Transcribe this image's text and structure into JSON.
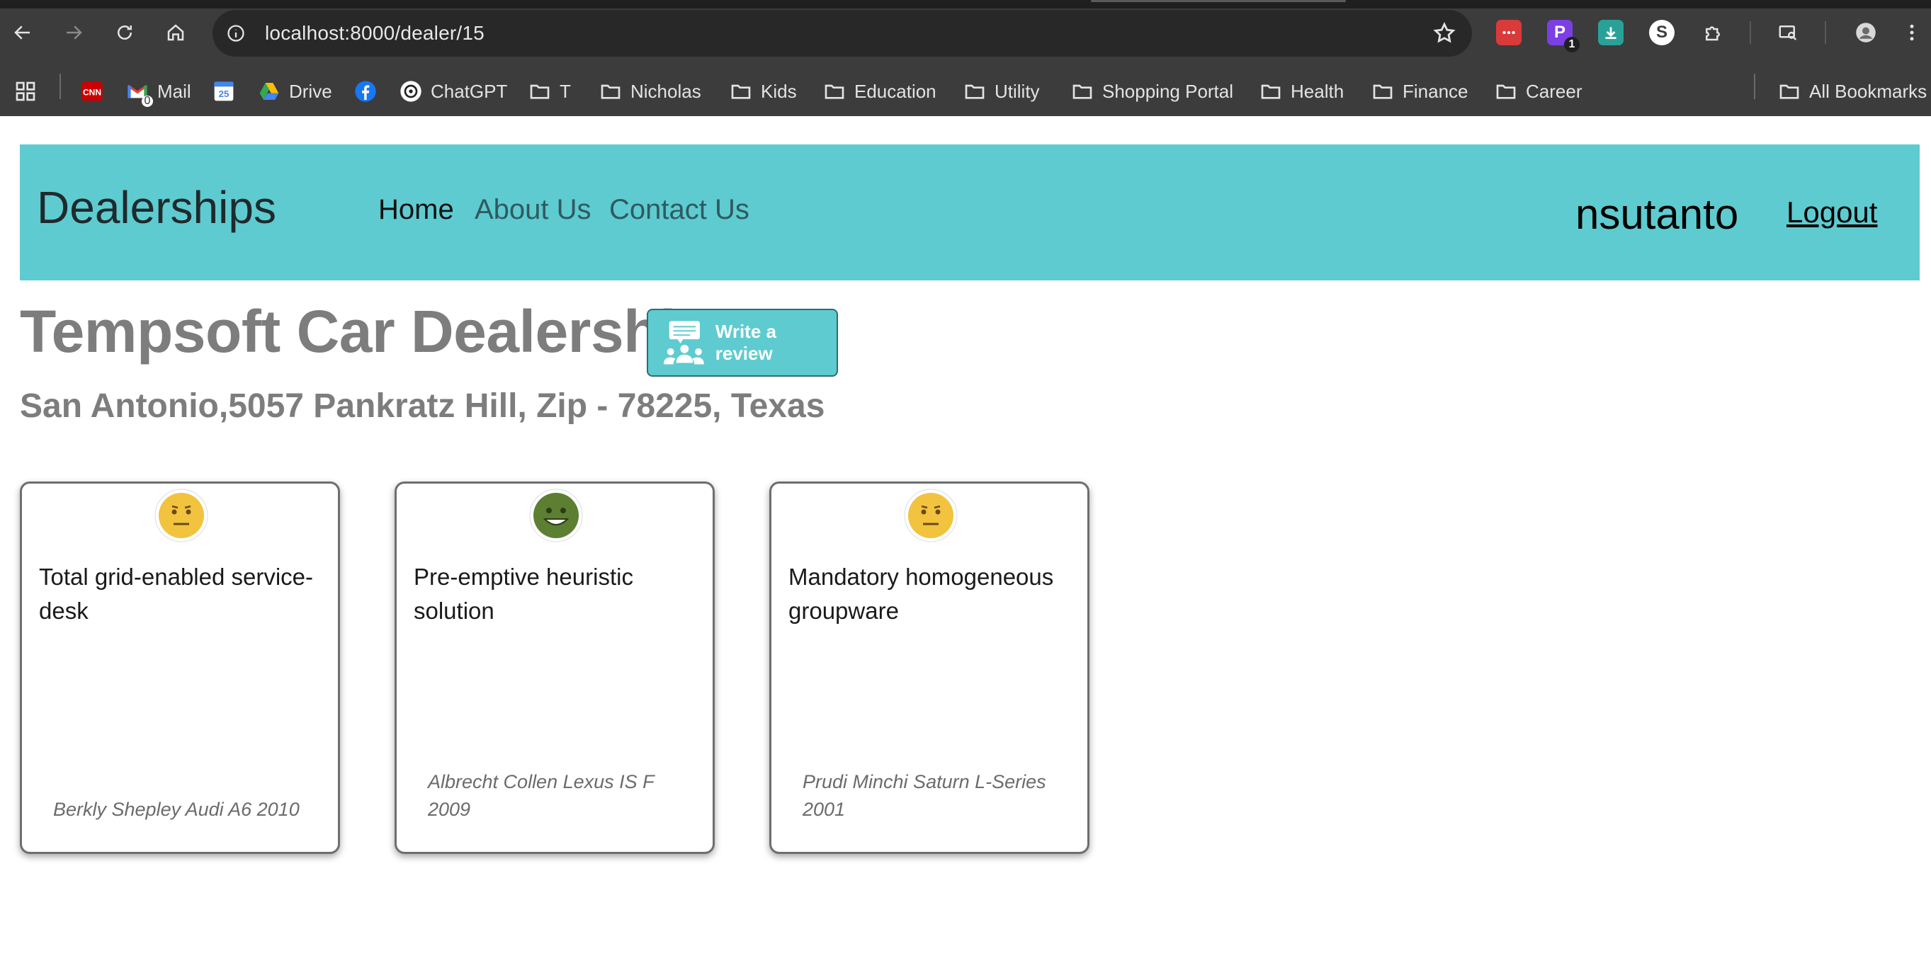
{
  "browser": {
    "url": "localhost:8000/dealer/15",
    "extensions": [
      {
        "name": "red-extension",
        "color": "#d93a3a"
      },
      {
        "name": "purple-extension",
        "label": "P",
        "badge": "1",
        "color": "#7b3fe4"
      },
      {
        "name": "download-extension",
        "color": "#2aa198"
      },
      {
        "name": "s-extension",
        "label": "S",
        "color": "#ffffff"
      }
    ],
    "bookmarks": {
      "mail": "Mail",
      "mail_badge": "0",
      "calendar_day": "25",
      "drive": "Drive",
      "chatgpt": "ChatGPT",
      "t": "T",
      "nicholas": "Nicholas",
      "kids": "Kids",
      "education": "Education",
      "utility": "Utility",
      "shopping": "Shopping Portal",
      "health": "Health",
      "finance": "Finance",
      "career": "Career",
      "all": "All Bookmarks"
    }
  },
  "nav": {
    "brand": "Dealerships",
    "home": "Home",
    "about": "About Us",
    "contact": "Contact Us",
    "username": "nsutanto",
    "logout": "Logout"
  },
  "dealer": {
    "name": "Tempsoft Car Dealership",
    "write_review": "Write a review",
    "address": "San Antonio,5057 Pankratz Hill, Zip - 78225, Texas"
  },
  "reviews": [
    {
      "text": "Total grid-enabled service-desk",
      "reviewer": "Berkly Shepley Audi A6 2010",
      "sentiment": "neutral",
      "face_color": "#f2c33e"
    },
    {
      "text": "Pre-emptive heuristic solution",
      "reviewer": "Albrecht Collen Lexus IS F 2009",
      "sentiment": "positive",
      "face_color": "#5c7f32"
    },
    {
      "text": "Mandatory homogeneous groupware",
      "reviewer": "Prudi Minchi Saturn L-Series 2001",
      "sentiment": "neutral",
      "face_color": "#f2c33e"
    }
  ],
  "colors": {
    "accent": "#5ecbd0",
    "title_gray": "#7d7d7d",
    "chrome_bg": "#3c3c3c"
  }
}
